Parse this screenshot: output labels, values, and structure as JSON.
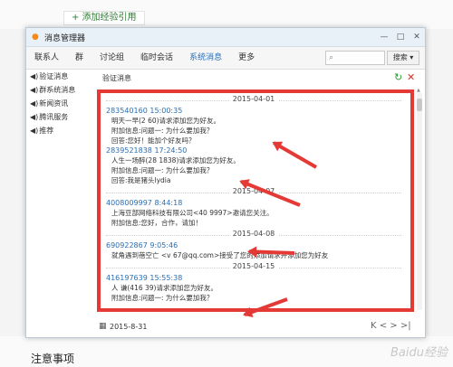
{
  "background": {
    "top_link": "+ 添加经验引用",
    "notes_title": "注意事项",
    "watermark": "Baidu经验"
  },
  "window": {
    "title": "消息管理器",
    "minimize": "—",
    "maximize": "□",
    "close": "✕"
  },
  "tabs": [
    "联系人",
    "群",
    "讨论组",
    "临时会话",
    "系统消息",
    "更多"
  ],
  "active_tab": "系统消息",
  "search": {
    "placeholder": "",
    "button_label": "搜索 ▾"
  },
  "sidebar": {
    "items": [
      {
        "label": "验证消息"
      },
      {
        "label": "群系统消息"
      },
      {
        "label": "新闻资讯"
      },
      {
        "label": "腾讯服务"
      },
      {
        "label": "推荐"
      }
    ]
  },
  "pane": {
    "title": "验证消息"
  },
  "messages": {
    "d1": "2015-04-01",
    "m1_sender": "283540160 15:00:35",
    "m1_l1": "明天一早(2         60)请求添加您为好友。",
    "m1_l2": "附加信息:问题一: 为什么要加我？",
    "m1_l3": "回答:您好！能加个好友吗？",
    "m2_sender": "2839521838 17:24:50",
    "m2_l1": "人生一场醉(28        1838)请求添加您为好友。",
    "m2_l2": "附加信息:问题一: 为什么要加我？",
    "m2_l3": "回答:我是猪头lydia",
    "d2": "2015-04-07",
    "m3_sender": "4008009997 8:44:18",
    "m3_l1": "上海豆部网络科技有限公司<40         9997>邀请您关注。",
    "m3_l2": "附加信息:您好，合作，请加！",
    "d3": "2015-04-08",
    "m4_sender": "690922867 9:05:46",
    "m4_l1": "就角遇到蓓空亡  <v         67@qq.com>接受了您的添加请求并添加您为好友",
    "d4": "2015-04-15",
    "m5_sender": "416197639 15:55:38",
    "m5_l1": "人 谦(416        39)请求添加您为好友。",
    "m5_l2": "附加信息:问题一: 为什么要加我？"
  },
  "footer": {
    "date": "2015-8-31",
    "pager": "K < > >|"
  },
  "colors": {
    "highlight": "#e53935",
    "link_blue": "#2a6eb5",
    "title_bg": "#e8f0f8"
  }
}
